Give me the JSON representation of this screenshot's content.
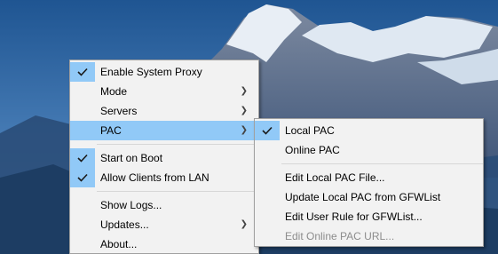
{
  "tray_menu": {
    "items": [
      {
        "label": "Enable System Proxy",
        "checked": true
      },
      {
        "label": "Mode",
        "submenu": true
      },
      {
        "label": "Servers",
        "submenu": true
      },
      {
        "label": "PAC",
        "submenu": true,
        "highlighted": true
      },
      {
        "label": "Start on Boot",
        "checked": true
      },
      {
        "label": "Allow Clients from LAN",
        "checked": true
      },
      {
        "label": "Show Logs..."
      },
      {
        "label": "Updates...",
        "submenu": true
      },
      {
        "label": "About..."
      }
    ]
  },
  "pac_submenu": {
    "items": [
      {
        "label": "Local PAC",
        "checked": true
      },
      {
        "label": "Online PAC"
      },
      {
        "label": "Edit Local PAC File..."
      },
      {
        "label": "Update Local PAC from GFWList"
      },
      {
        "label": "Edit User Rule for GFWList..."
      },
      {
        "label": "Edit Online PAC URL...",
        "disabled": true
      }
    ]
  },
  "colors": {
    "menu_background": "#f2f2f2",
    "highlight": "#91c9f7",
    "disabled_text": "#8c8c8c",
    "sky_top": "#2c5f9a",
    "sky_bottom": "#6d9fca"
  },
  "icons": {
    "check": "checkmark-icon",
    "submenu_arrow": "chevron-right-icon"
  }
}
